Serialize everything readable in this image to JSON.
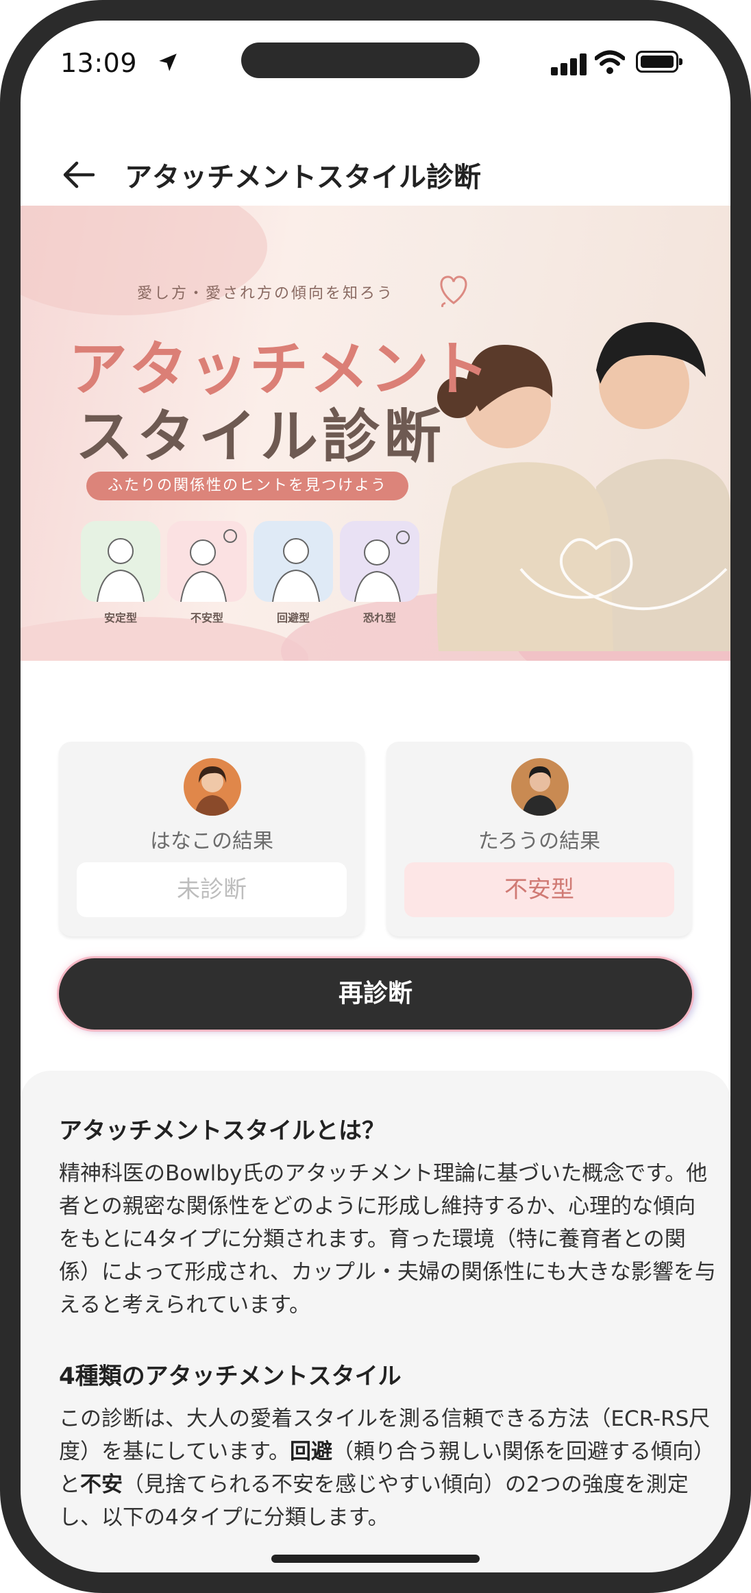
{
  "status_bar": {
    "time": "13:09"
  },
  "header": {
    "title": "アタッチメントスタイル診断"
  },
  "hero": {
    "subtitle": "愛し方・愛され方の傾向を知ろう",
    "title_line1": "アタッチメント",
    "title_line2": "スタイル診断",
    "pill": "ふたりの関係性のヒントを見つけよう",
    "types": [
      {
        "label": "安定型",
        "color": "#e6f2e3"
      },
      {
        "label": "不安型",
        "color": "#fbe1e2"
      },
      {
        "label": "回避型",
        "color": "#dfeaf6"
      },
      {
        "label": "恐れ型",
        "color": "#e9e1f4"
      }
    ]
  },
  "results": {
    "left": {
      "label": "はなこの結果",
      "value": "未診断"
    },
    "right": {
      "label": "たろうの結果",
      "value": "不安型"
    }
  },
  "rediagnose_label": "再診断",
  "info": {
    "heading1": "アタッチメントスタイルとは？",
    "para1": "精神科医のBowlby氏のアタッチメント理論に基づいた概念です。他者との親密な関係性をどのように形成し維持するか、心理的な傾向をもとに4タイプに分類されます。育った環境（特に養育者との関係）によって形成され、カップル・夫婦の関係性にも大きな影響を与えると考えられています。",
    "heading2": "4種類のアタッチメントスタイル",
    "para2_a": "この診断は、大人の愛着スタイルを測る信頼できる方法（ECR-RS尺度）を基にしています。",
    "para2_b1": "回避",
    "para2_c": "（頼り合う親しい関係を回避する傾向）と",
    "para2_b2": "不安",
    "para2_d": "（見捨てられる不安を感じやすい傾向）の2つの強度を測定し、以下の4タイプに分類します。"
  },
  "colors": {
    "accent": "#db7f76",
    "button_bg": "#2f2f2f",
    "result_highlight": "#fde6e6"
  }
}
